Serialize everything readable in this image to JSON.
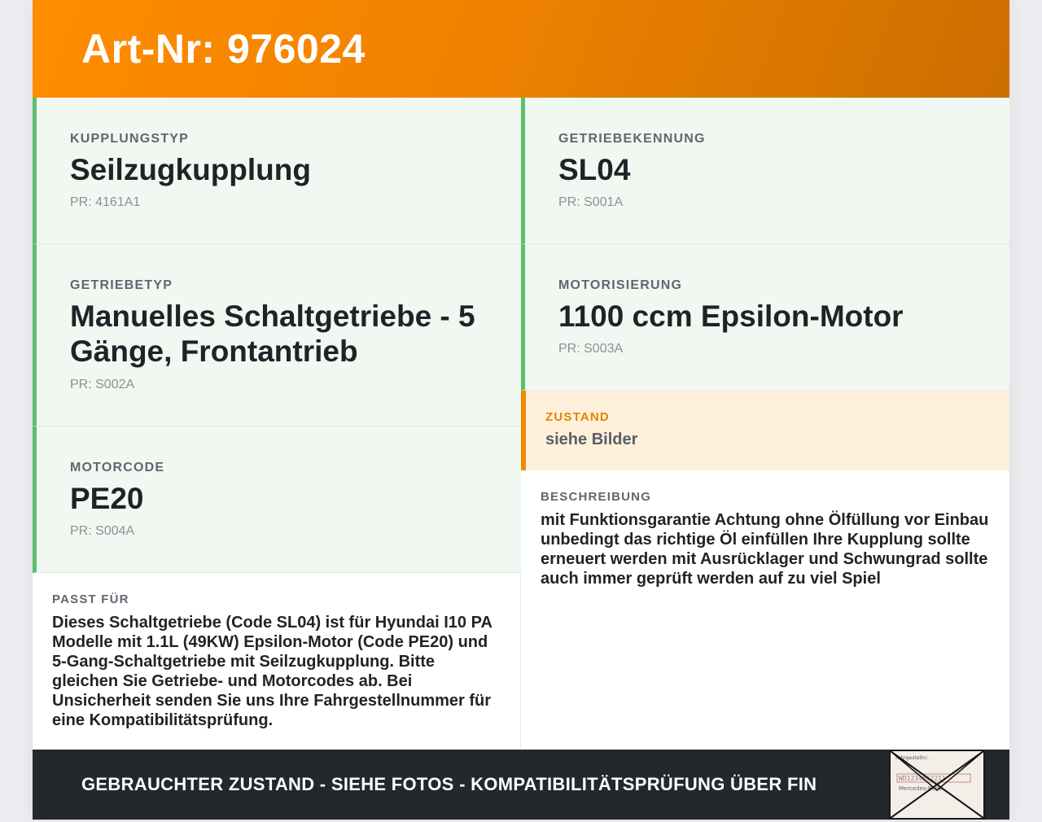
{
  "header": {
    "title": "Art-Nr: 976024"
  },
  "specs_left": [
    {
      "label": "KUPPLUNGSTYP",
      "value": "Seilzugkupplung",
      "pr": "PR: 4161A1"
    },
    {
      "label": "GETRIEBETYP",
      "value": "Manuelles Schaltgetriebe - 5 Gänge, Frontantrieb",
      "pr": "PR: S002A"
    },
    {
      "label": "MOTORCODE",
      "value": "PE20",
      "pr": "PR: S004A"
    }
  ],
  "specs_right": [
    {
      "label": "GETRIEBEKENNUNG",
      "value": "SL04",
      "pr": "PR: S001A"
    },
    {
      "label": "MOTORISIERUNG",
      "value": "1100 ccm Epsilon-Motor",
      "pr": "PR: S003A"
    }
  ],
  "state": {
    "label": "ZUSTAND",
    "value": "siehe Bilder"
  },
  "fits": {
    "label": "PASST FÜR",
    "text": "Dieses Schaltgetriebe (Code SL04) ist für Hyundai I10 PA Modelle mit 1.1L (49KW) Epsilon-Motor (Code PE20) und 5-Gang-Schaltgetriebe mit Seilzugkupplung. Bitte gleichen Sie Getriebe- und Motorcodes ab. Bei Unsicherheit senden Sie uns Ihre Fahrgestellnummer für eine Kompatibilitätsprüfung."
  },
  "description": {
    "label": "BESCHREIBUNG",
    "text": "mit Funktionsgarantie Achtung ohne Ölfüllung vor Einbau unbedingt das richtige Öl einfüllen Ihre Kupplung sollte erneuert werden mit Ausrücklager und Schwungrad sollte auch immer geprüft werden auf zu viel Spiel"
  },
  "footer": {
    "text": "GEBRAUCHTER ZUSTAND - SIEHE FOTOS - KOMPATIBILITÄTSPRÜFUNG ÜBER FIN"
  },
  "thumbnail": {
    "icon": "envelope-photo-icon",
    "text_top": "Fahrgestellnr.",
    "text_code": "WD1234562211",
    "text_brand": "Mercedes-Benz"
  },
  "colors": {
    "accent": "#ff8c00",
    "spec_border": "#5cbf6c",
    "spec_bg": "#f1f8f1",
    "state_bg": "#fff0dc",
    "footer_bg": "#24272b"
  }
}
